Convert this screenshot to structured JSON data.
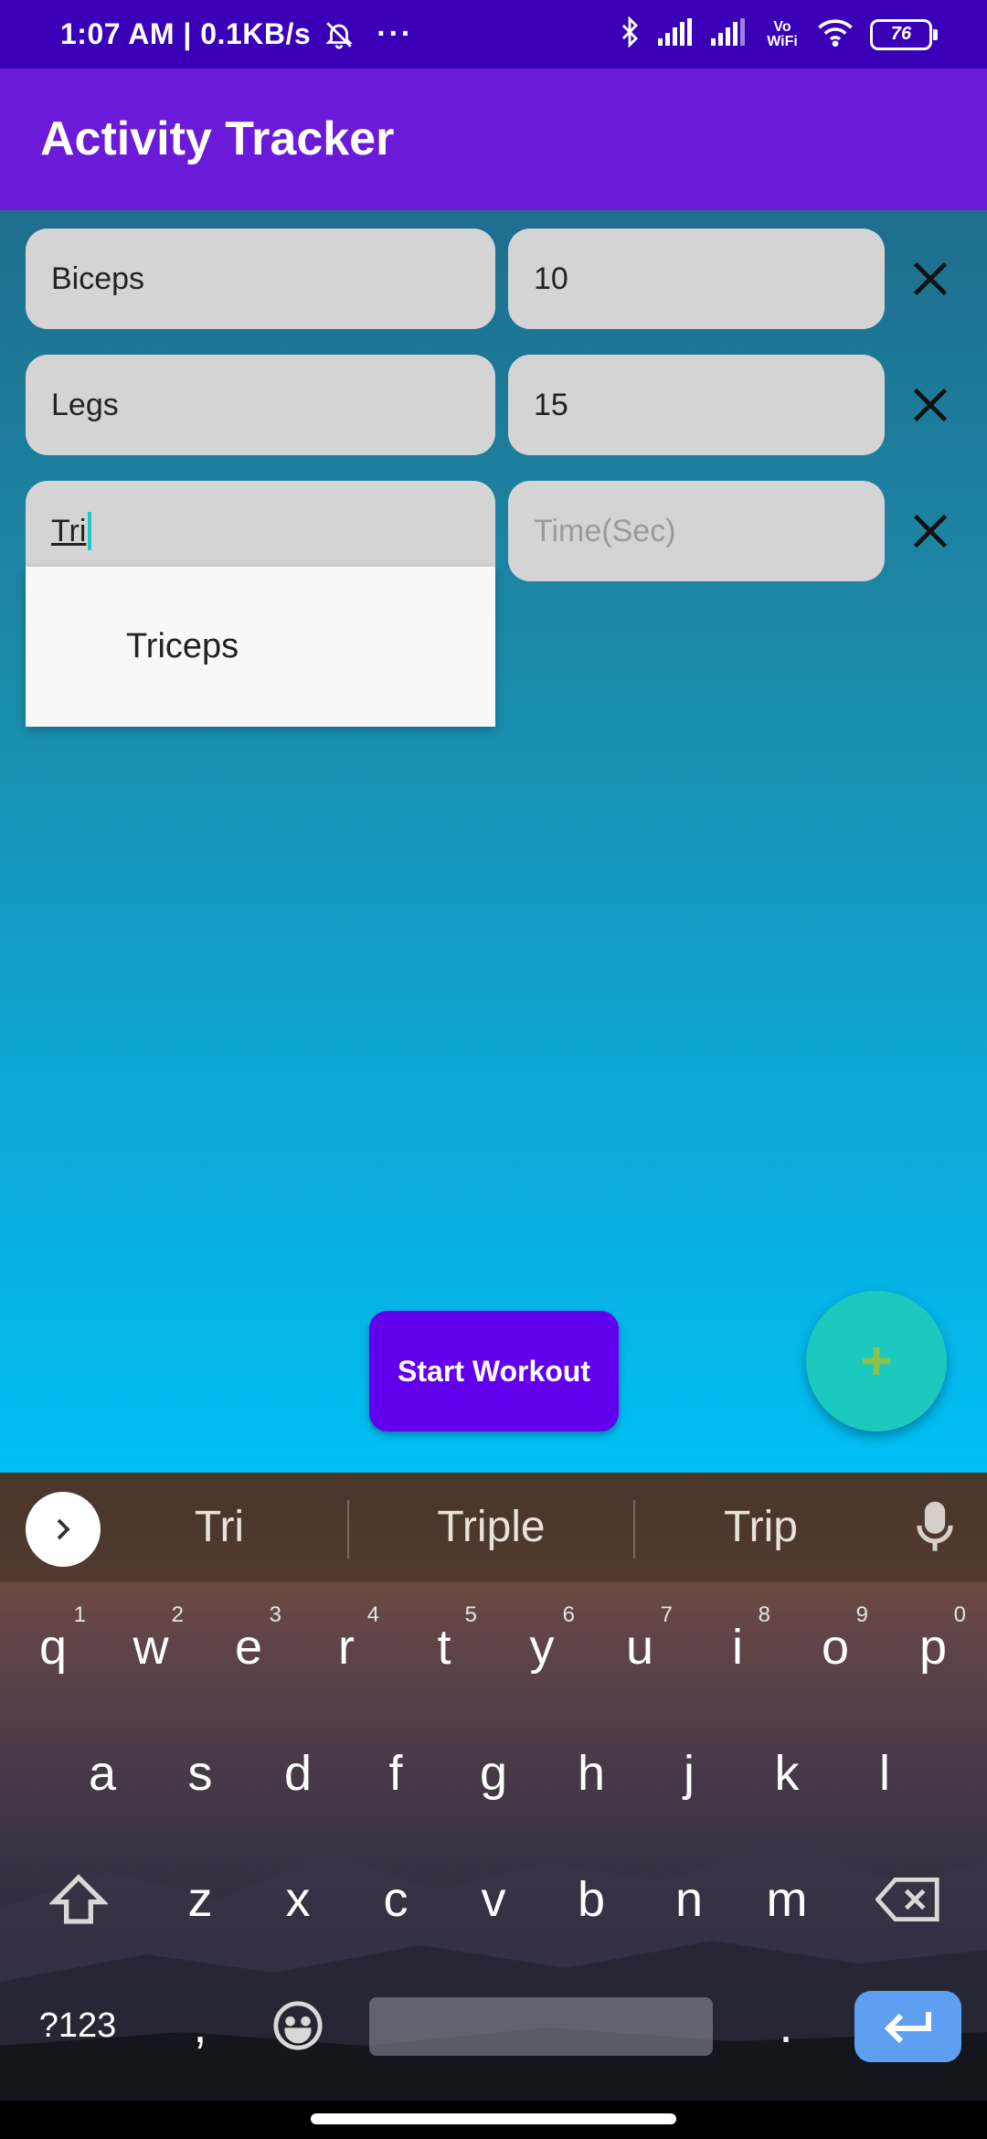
{
  "status_bar": {
    "time_and_speed": "1:07 AM | 0.1KB/s",
    "more_dots": "···",
    "wifi_label": "Vo WiFi",
    "battery": "76"
  },
  "app_bar": {
    "title": "Activity Tracker"
  },
  "activities": [
    {
      "name": "Biceps",
      "time": "10"
    },
    {
      "name": "Legs",
      "time": "15"
    },
    {
      "name_typed": "Tri",
      "time_placeholder": "Time(Sec)"
    }
  ],
  "autocomplete": {
    "item": "Triceps"
  },
  "buttons": {
    "start_workout": "Start Workout",
    "add_icon": "plus-icon"
  },
  "keyboard": {
    "suggestions": [
      "Tri",
      "Triple",
      "Trip"
    ],
    "row1": [
      {
        "k": "q",
        "n": "1"
      },
      {
        "k": "w",
        "n": "2"
      },
      {
        "k": "e",
        "n": "3"
      },
      {
        "k": "r",
        "n": "4"
      },
      {
        "k": "t",
        "n": "5"
      },
      {
        "k": "y",
        "n": "6"
      },
      {
        "k": "u",
        "n": "7"
      },
      {
        "k": "i",
        "n": "8"
      },
      {
        "k": "o",
        "n": "9"
      },
      {
        "k": "p",
        "n": "0"
      }
    ],
    "row2": [
      "a",
      "s",
      "d",
      "f",
      "g",
      "h",
      "j",
      "k",
      "l"
    ],
    "row3": [
      "z",
      "x",
      "c",
      "v",
      "b",
      "n",
      "m"
    ],
    "symbols_key": "?123",
    "comma_key": ",",
    "period_key": "."
  },
  "colors": {
    "status_bar": "#3a00b8",
    "app_bar": "#6a1ad8",
    "start_button": "#6200ee",
    "fab": "#1cc9bf",
    "fab_plus": "#8bc34a",
    "enter_key": "#5f9ff2"
  }
}
